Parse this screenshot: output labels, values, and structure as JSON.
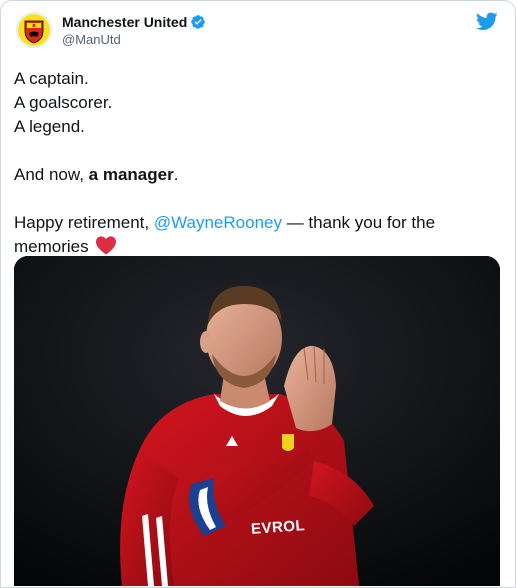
{
  "tweet": {
    "display_name": "Manchester United",
    "handle": "@ManUtd",
    "lines": [
      "A captain.",
      "A goalscorer.",
      "A legend."
    ],
    "para2_prefix": "And now, ",
    "para2_bold": "a manager",
    "para2_suffix": ".",
    "para3_prefix": "Happy retirement, ",
    "mention": "@WayneRooney",
    "para3_middle": " — thank you for the memories ",
    "kit_sponsor_text": "EVROL"
  },
  "icons": {
    "avatar": "manchester-united-crest",
    "verified": "verified-badge-icon",
    "platform": "twitter-bird-icon",
    "heart": "red-heart-emoji"
  },
  "colors": {
    "link": "#1d9bf0",
    "verified": "#1d9bf0",
    "heart": "#dd2e44",
    "shirt": "#c8102e"
  }
}
